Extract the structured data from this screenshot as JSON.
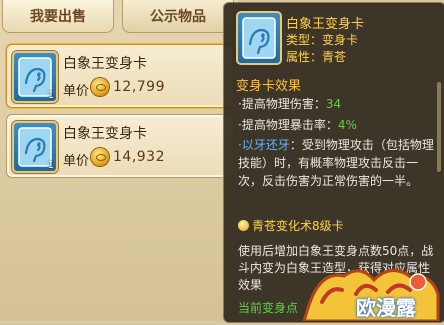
{
  "tabs": {
    "sell_label": "我要出售",
    "public_label": "公示物品"
  },
  "items": [
    {
      "name": "白象王变身卡",
      "price_label": "单价",
      "price": "12,799",
      "qty": "1",
      "icon": "transform-card-icon"
    },
    {
      "name": "白象王变身卡",
      "price_label": "单价",
      "price": "14,932",
      "qty": "1",
      "icon": "transform-card-icon"
    }
  ],
  "tooltip": {
    "title": "白象王变身卡",
    "type": "类型：变身卡",
    "attribute": "属性：青苍",
    "effect_heading": "变身卡效果",
    "effects": [
      {
        "label": "·提高物理伤害：",
        "value": "34"
      },
      {
        "label": "·提高物理暴击率：",
        "value": "4%"
      }
    ],
    "skill_name": "·以牙还牙",
    "skill_desc": "：受到物理攻击（包括物理技能）时，有概率物理攻击反击一次，反击伤害为正常伤害的一半。",
    "rank": "青苍变化术8级卡",
    "usage": "使用后增加白象王变身点数50点，战斗内变为白象王造型，获得对应属性效果",
    "current": "当前变身点"
  },
  "branding": {
    "watermark": "欧漫露"
  },
  "colors": {
    "tooltip_bg": "#302a1e",
    "gold_text": "#ffd24a",
    "green_value": "#5fd04a",
    "skill_blue": "#5fb8ff"
  }
}
